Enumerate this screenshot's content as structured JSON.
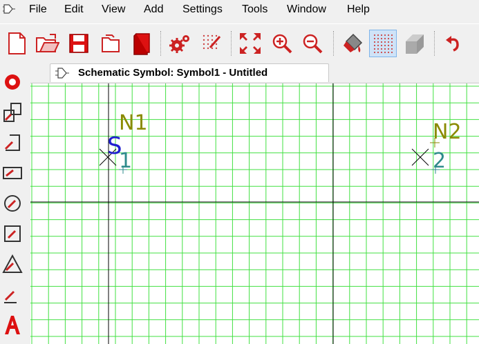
{
  "menu": {
    "items": [
      "File",
      "Edit",
      "View",
      "Add",
      "Settings",
      "Tools",
      "Window",
      "Help"
    ]
  },
  "toolbar": {
    "buttons": [
      "new-file",
      "open-folder",
      "save",
      "open-copy",
      "library",
      "settings-gear",
      "grid-pick",
      "zoom-extents",
      "zoom-in",
      "zoom-out",
      "fill",
      "show-grid",
      "shape-3d",
      "undo"
    ],
    "active": "show-grid"
  },
  "left_tools": [
    "circle-pin",
    "rect-tool-1",
    "line-tool",
    "rect-tool-2",
    "ellipse-tool",
    "square-tool",
    "triangle-tool",
    "pencil-tool",
    "text-tool"
  ],
  "tab": {
    "title": "Schematic Symbol: Symbol1 - Untitled"
  },
  "canvas": {
    "pins": [
      {
        "net": "N1",
        "number": "1"
      },
      {
        "net": "N2",
        "number": "2"
      }
    ],
    "symbol_letter": "S",
    "colors": {
      "grid": "#40e040",
      "axis": "#000000",
      "net": "#8a8a00",
      "pin_number": "#2e8b8b",
      "symbol_letter": "#1f1fcf",
      "cursor_cross": "#000000"
    }
  },
  "colors": {
    "accent_red": "#cc1111",
    "active_bg": "#cfe3f7"
  }
}
